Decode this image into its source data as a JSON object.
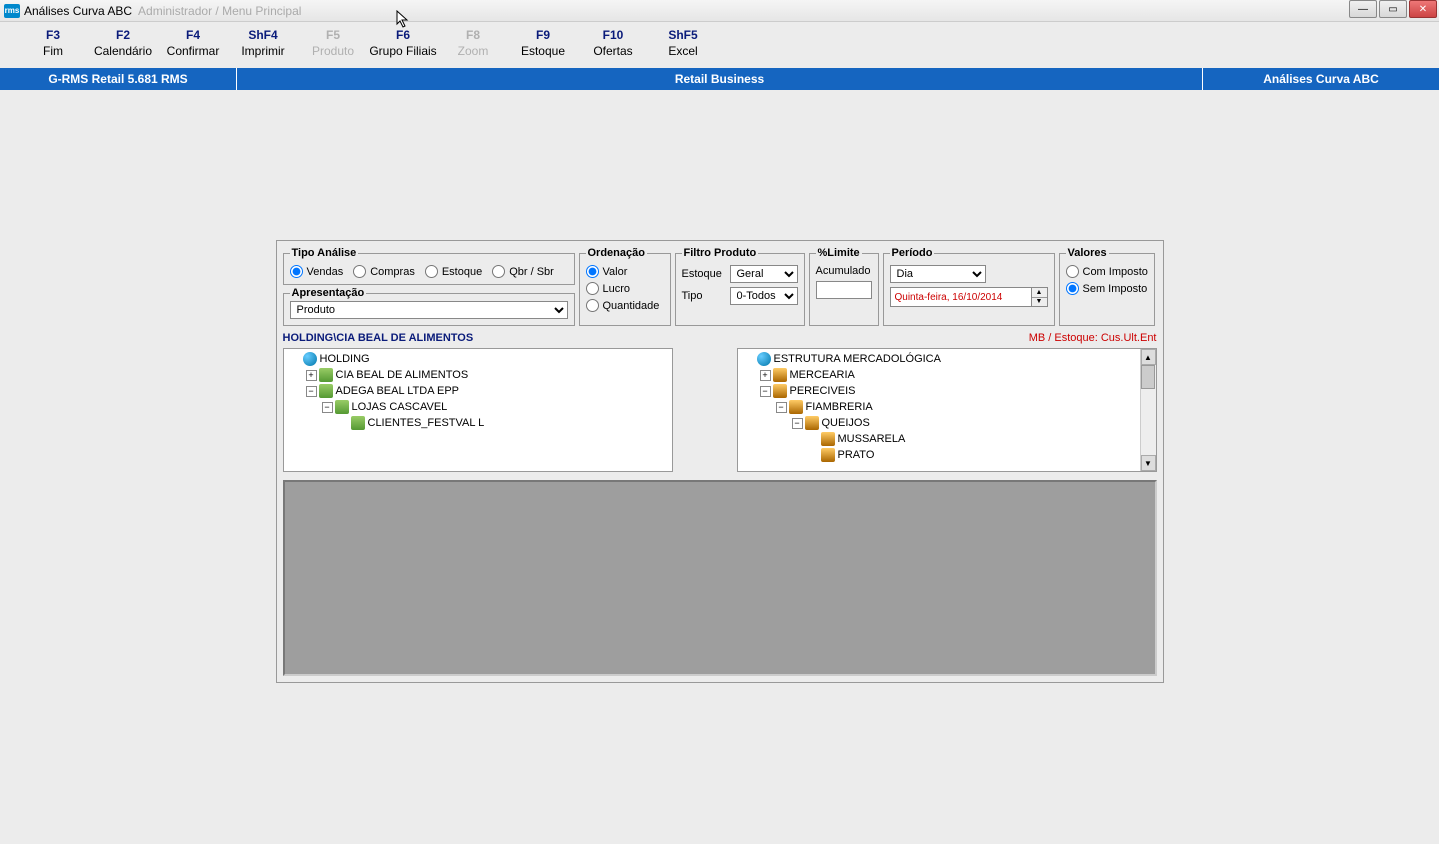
{
  "window": {
    "app_icon": "rms",
    "title": "Análises Curva ABC",
    "subtitle": "Administrador / Menu Principal"
  },
  "fkeys": [
    {
      "key": "F3",
      "label": "Fim",
      "disabled": false
    },
    {
      "key": "F2",
      "label": "Calendário",
      "disabled": false
    },
    {
      "key": "F4",
      "label": "Confirmar",
      "disabled": false
    },
    {
      "key": "ShF4",
      "label": "Imprimir",
      "disabled": false
    },
    {
      "key": "F5",
      "label": "Produto",
      "disabled": true
    },
    {
      "key": "F6",
      "label": "Grupo Filiais",
      "disabled": false
    },
    {
      "key": "F8",
      "label": "Zoom",
      "disabled": true
    },
    {
      "key": "F9",
      "label": "Estoque",
      "disabled": false
    },
    {
      "key": "F10",
      "label": "Ofertas",
      "disabled": false
    },
    {
      "key": "ShF5",
      "label": "Excel",
      "disabled": false
    }
  ],
  "bluebar": {
    "left": "G-RMS Retail 5.681 RMS",
    "center": "Retail Business",
    "right": "Análises Curva ABC"
  },
  "groups": {
    "tipo_legend": "Tipo Análise",
    "tipo_options": [
      "Vendas",
      "Compras",
      "Estoque",
      "Qbr / Sbr"
    ],
    "apres_legend": "Apresentação",
    "apres_value": "Produto",
    "orden_legend": "Ordenação",
    "orden_options": [
      "Valor",
      "Lucro",
      "Quantidade"
    ],
    "filtro_legend": "Filtro Produto",
    "filtro_estoque_label": "Estoque",
    "filtro_estoque_value": "Geral",
    "filtro_tipo_label": "Tipo",
    "filtro_tipo_value": "0-Todos",
    "limite_legend": "%Limite",
    "limite_label": "Acumulado",
    "limite_value": "",
    "periodo_legend": "Período",
    "periodo_value": "Dia",
    "periodo_date": "Quinta-feira, 16/10/2014",
    "valores_legend": "Valores",
    "valores_options": [
      "Com Imposto",
      "Sem Imposto"
    ]
  },
  "path": {
    "left": "HOLDING\\CIA BEAL DE ALIMENTOS",
    "right": "MB / Estoque: Cus.Ult.Ent"
  },
  "tree_left": [
    {
      "indent": 1,
      "exp": "",
      "icon": "globe",
      "text": "HOLDING"
    },
    {
      "indent": 2,
      "exp": "+",
      "icon": "node",
      "text": "CIA BEAL DE ALIMENTOS"
    },
    {
      "indent": 2,
      "exp": "−",
      "icon": "node",
      "text": "ADEGA BEAL LTDA EPP"
    },
    {
      "indent": 3,
      "exp": "−",
      "icon": "node",
      "text": "LOJAS CASCAVEL"
    },
    {
      "indent": 4,
      "exp": "",
      "icon": "node",
      "text": "CLIENTES_FESTVAL L"
    }
  ],
  "tree_right": [
    {
      "indent": 1,
      "exp": "",
      "icon": "globe",
      "text": "ESTRUTURA MERCADOLÓGICA"
    },
    {
      "indent": 2,
      "exp": "+",
      "icon": "node2",
      "text": "MERCEARIA"
    },
    {
      "indent": 2,
      "exp": "−",
      "icon": "node2",
      "text": "PERECIVEIS"
    },
    {
      "indent": 3,
      "exp": "−",
      "icon": "node2",
      "text": "FIAMBRERIA"
    },
    {
      "indent": 4,
      "exp": "−",
      "icon": "node2",
      "text": "QUEIJOS"
    },
    {
      "indent": 5,
      "exp": "",
      "icon": "node2",
      "text": "MUSSARELA"
    },
    {
      "indent": 5,
      "exp": "",
      "icon": "node2",
      "text": "PRATO"
    }
  ]
}
